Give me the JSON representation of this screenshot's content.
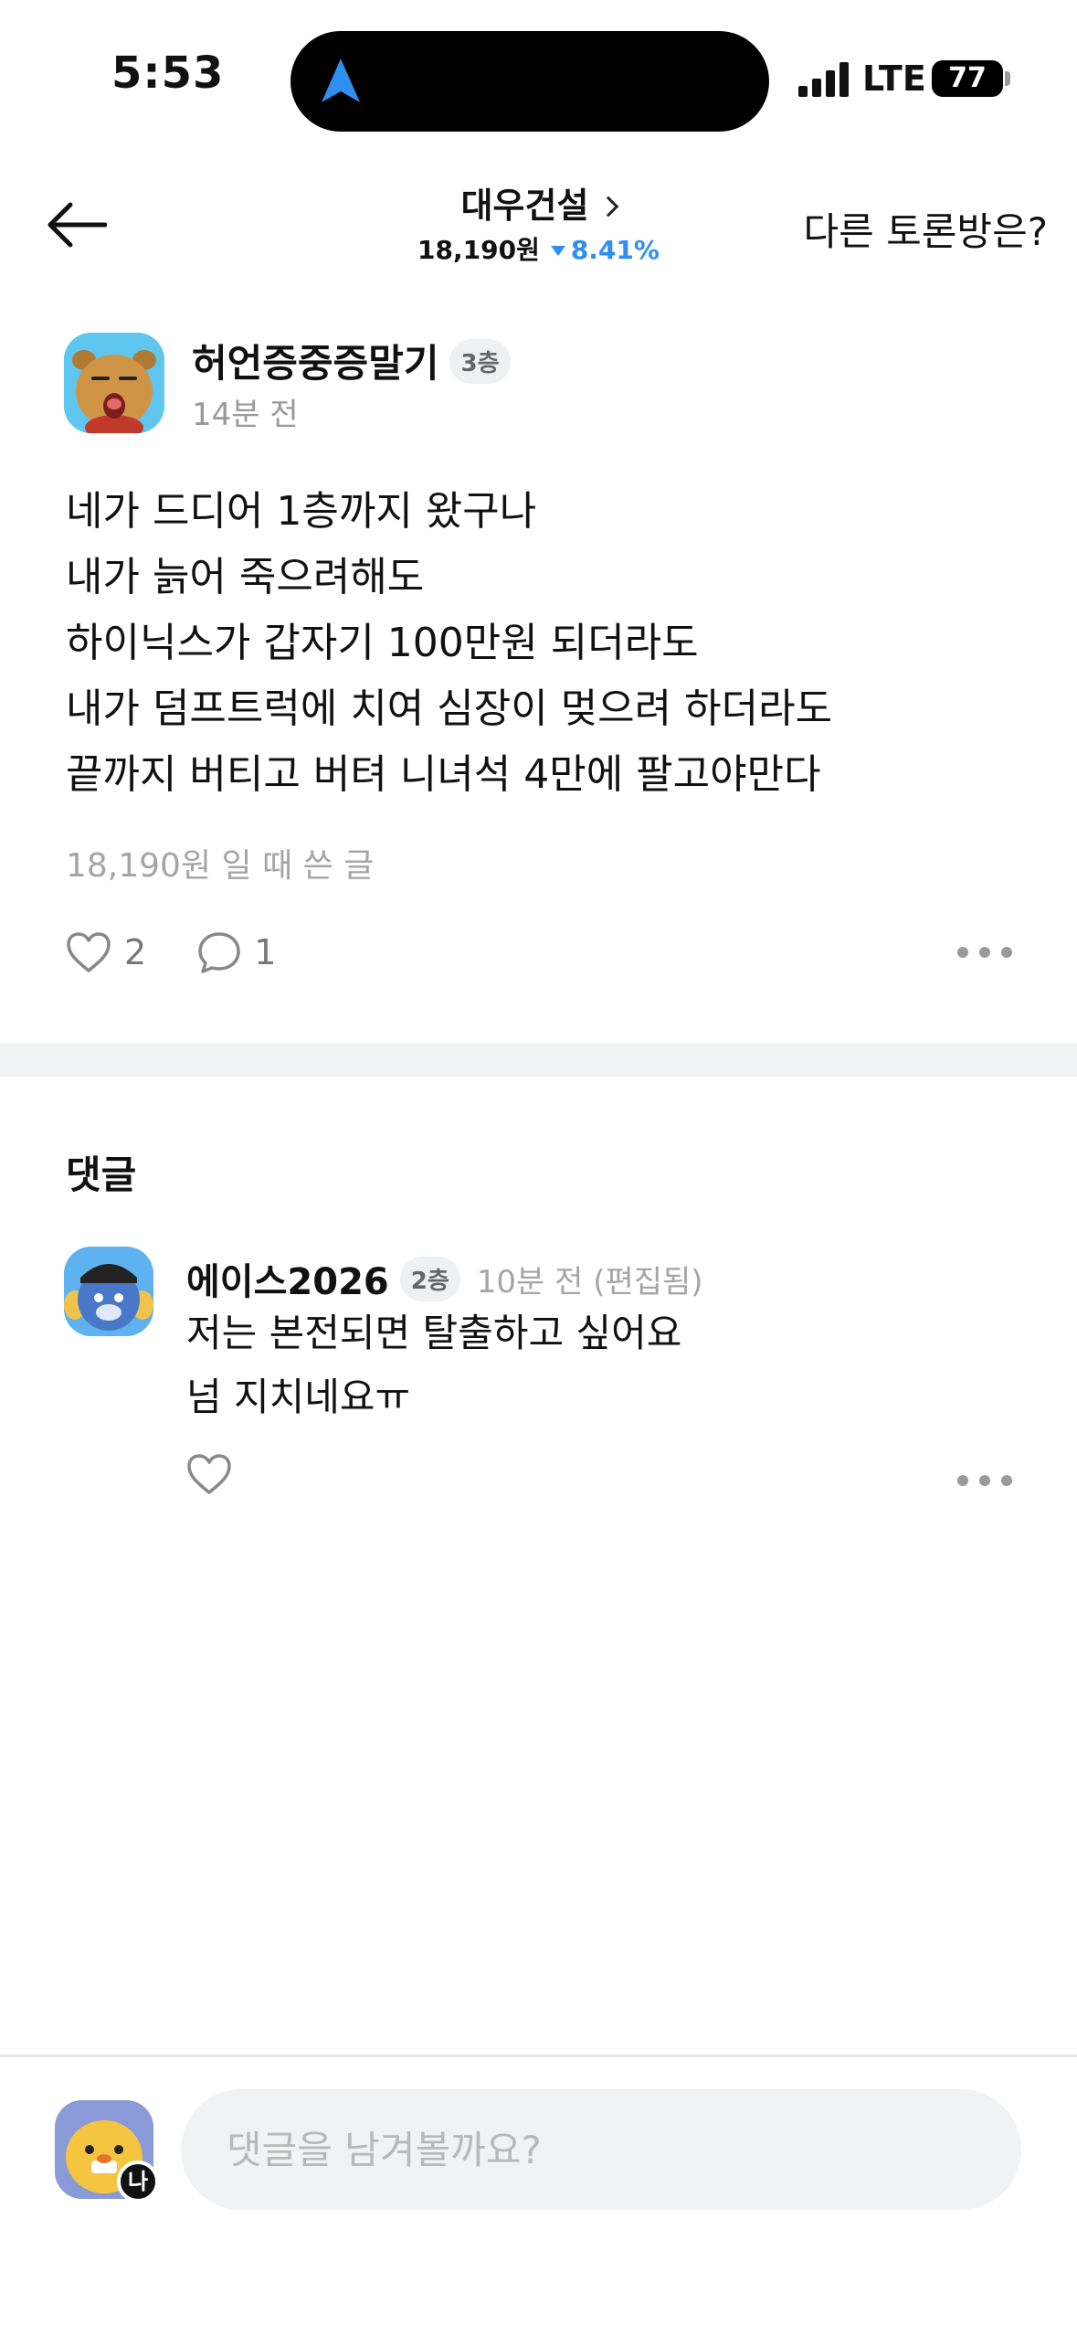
{
  "status_bar": {
    "time": "5:53",
    "network": "LTE",
    "battery": "77"
  },
  "header": {
    "stock_name": "대우건설",
    "price": "18,190원",
    "change": "8.41%",
    "change_color": "#2f8ff0",
    "other_rooms": "다른 토론방은?"
  },
  "post": {
    "author": "허언증중증말기",
    "floor": "3층",
    "time": "14분 전",
    "lines": [
      "네가 드디어 1층까지 왔구나",
      "내가 늙어 죽으려해도",
      "하이닉스가 갑자기 100만원 되더라도",
      "내가 덤프트럭에 치여 심장이 멎으려 하더라도",
      "끝까지 버티고 버텨 니녀석 4만에 팔고야만다"
    ],
    "footnote": "18,190원 일 때 쓴 글",
    "likes": "2",
    "comments": "1"
  },
  "comments_section": {
    "title": "댓글",
    "items": [
      {
        "author": "에이스2026",
        "floor": "2층",
        "time": "10분 전 (편집됨)",
        "lines": [
          "저는 본전되면 탈출하고 싶어요",
          "넘 지치네요ㅠ"
        ]
      }
    ]
  },
  "input": {
    "placeholder": "댓글을 남겨볼까요?",
    "me_badge": "나"
  }
}
